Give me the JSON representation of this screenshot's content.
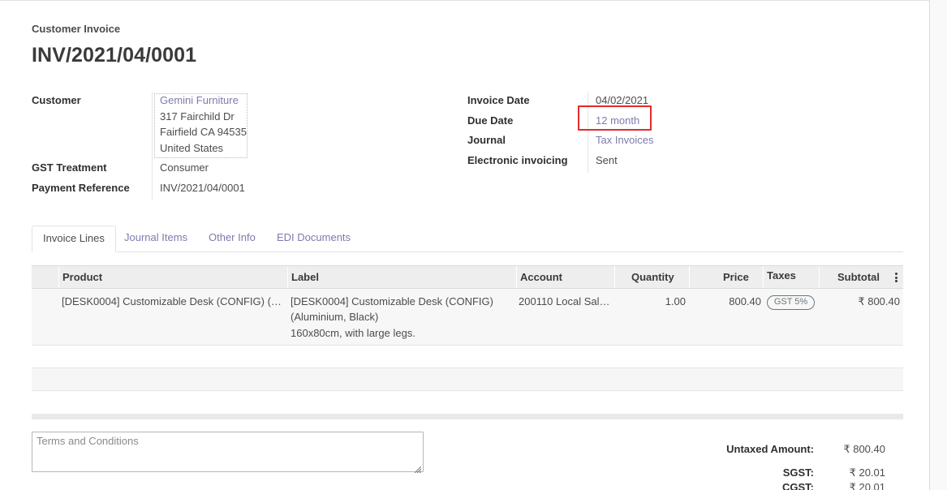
{
  "header": {
    "subtitle": "Customer Invoice",
    "title": "INV/2021/04/0001"
  },
  "left_fields": {
    "customer_label": "Customer",
    "customer_name": "Gemini Furniture",
    "address_line1": "317 Fairchild Dr",
    "address_line2": "Fairfield CA 94535",
    "address_line3": "United States",
    "gst_label": "GST Treatment",
    "gst_value": "Consumer",
    "payref_label": "Payment Reference",
    "payref_value": "INV/2021/04/0001"
  },
  "right_fields": {
    "invoice_date_label": "Invoice Date",
    "invoice_date_value": "04/02/2021",
    "due_date_label": "Due Date",
    "due_date_value": "12 month",
    "journal_label": "Journal",
    "journal_value": "Tax Invoices",
    "einvoicing_label": "Electronic invoicing",
    "einvoicing_value": "Sent"
  },
  "tabs": [
    {
      "label": "Invoice Lines",
      "active": true
    },
    {
      "label": "Journal Items",
      "active": false
    },
    {
      "label": "Other Info",
      "active": false
    },
    {
      "label": "EDI Documents",
      "active": false
    }
  ],
  "table": {
    "columns": {
      "product": "Product",
      "label": "Label",
      "account": "Account",
      "quantity": "Quantity",
      "price": "Price",
      "taxes": "Taxes",
      "subtotal": "Subtotal"
    },
    "rows": [
      {
        "product": "[DESK0004] Customizable Desk (CONFIG) (…",
        "label_line1": "[DESK0004] Customizable Desk (CONFIG)",
        "label_line2": "(Aluminium, Black)",
        "label_line3": "160x80cm, with large legs.",
        "account": "200110 Local Sal…",
        "quantity": "1.00",
        "price": "800.40",
        "tax_badge": "GST 5%",
        "subtotal": "₹ 800.40"
      }
    ]
  },
  "terms_placeholder": "Terms and Conditions",
  "totals": {
    "untaxed_label": "Untaxed Amount:",
    "untaxed_value": "₹ 800.40",
    "sgst_label": "SGST:",
    "sgst_value": "₹ 20.01",
    "cgst_label": "CGST:",
    "cgst_value": "₹ 20.01"
  },
  "colors": {
    "link": "#7c7bad",
    "highlight_box": "#e02b2b"
  }
}
